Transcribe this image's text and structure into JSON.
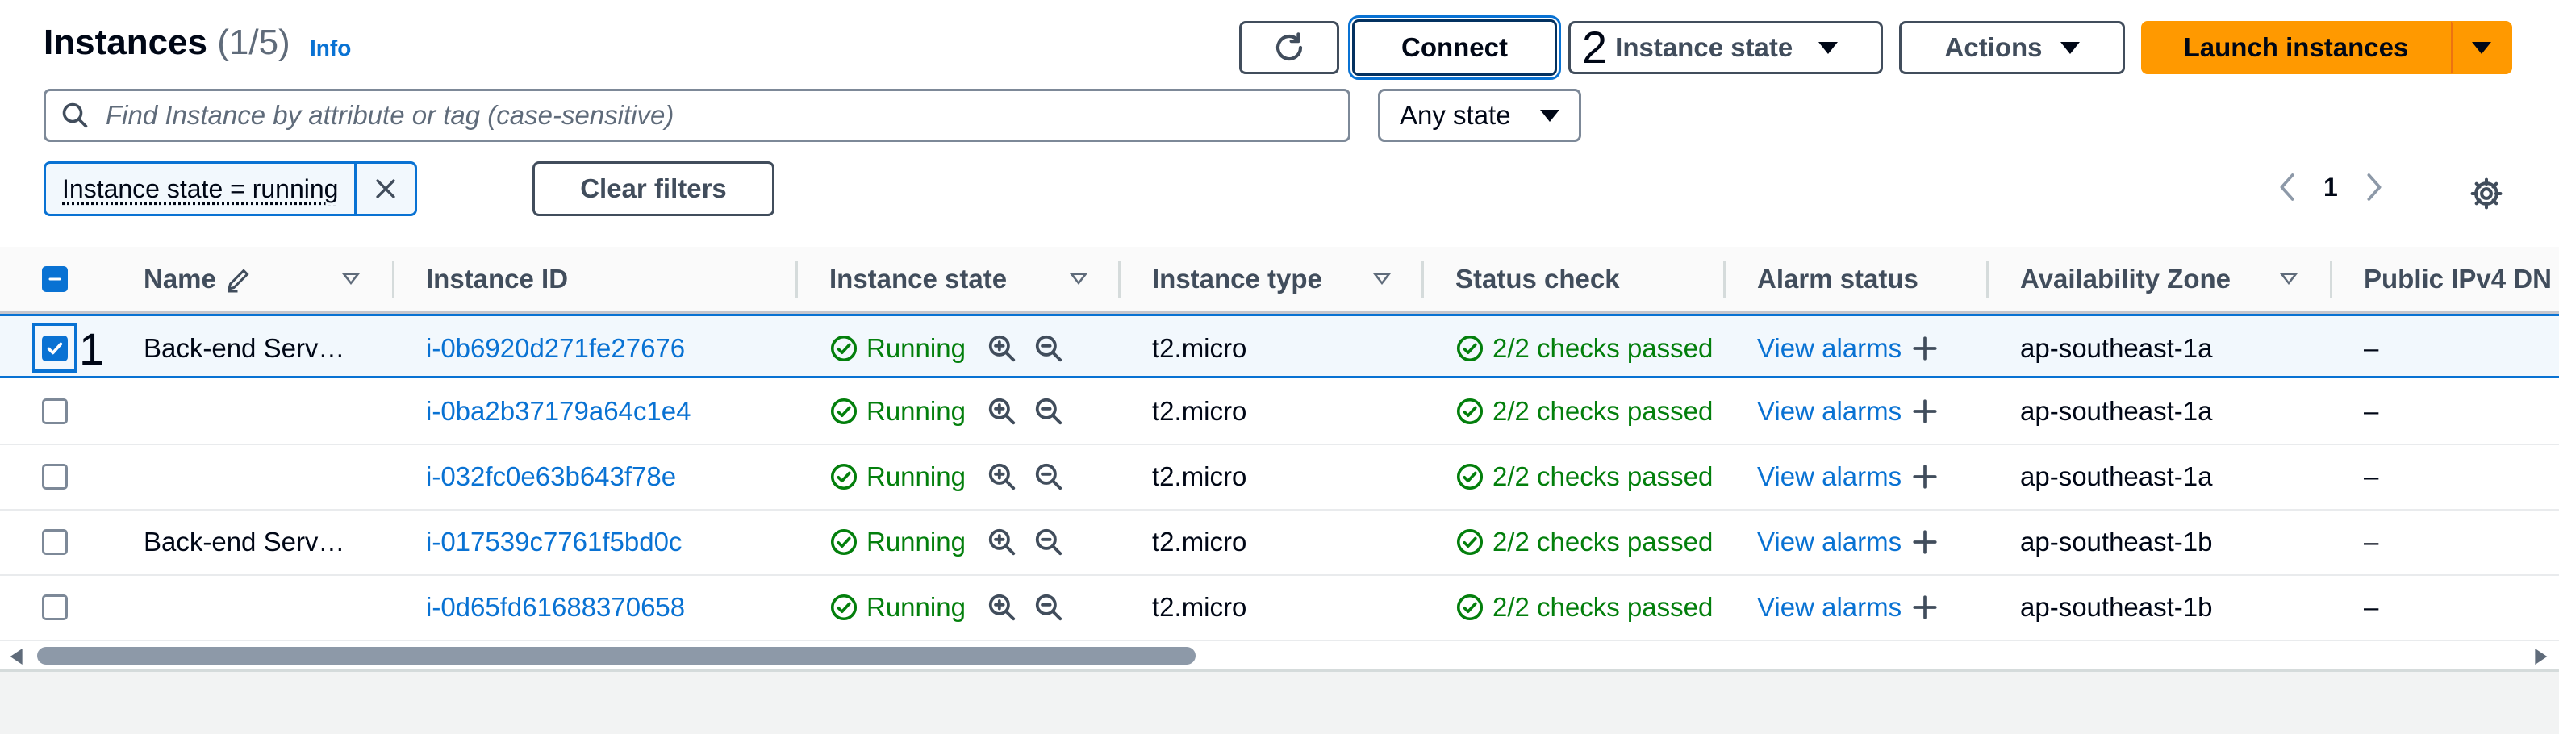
{
  "header": {
    "title": "Instances",
    "count": "(1/5)",
    "info": "Info"
  },
  "toolbar": {
    "connect_label": "Connect",
    "instance_state_marker": "2",
    "instance_state_label": "Instance state",
    "actions_label": "Actions",
    "launch_label": "Launch instances"
  },
  "search": {
    "placeholder": "Find Instance by attribute or tag (case-sensitive)",
    "state_filter": "Any state"
  },
  "filters": {
    "token": "Instance state = running",
    "clear_label": "Clear filters"
  },
  "pagination": {
    "page": "1"
  },
  "table": {
    "columns": [
      "Name",
      "Instance ID",
      "Instance state",
      "Instance type",
      "Status check",
      "Alarm status",
      "Availability Zone",
      "Public IPv4 DN"
    ],
    "rows": [
      {
        "selected": true,
        "marker": "1",
        "name": "Back-end Serv…",
        "id": "i-0b6920d271fe27676",
        "state": "Running",
        "type": "t2.micro",
        "status": "2/2 checks passed",
        "alarm": "View alarms",
        "az": "ap-southeast-1a",
        "ipv4": "–"
      },
      {
        "selected": false,
        "marker": "",
        "name": "",
        "id": "i-0ba2b37179a64c1e4",
        "state": "Running",
        "type": "t2.micro",
        "status": "2/2 checks passed",
        "alarm": "View alarms",
        "az": "ap-southeast-1a",
        "ipv4": "–"
      },
      {
        "selected": false,
        "marker": "",
        "name": "",
        "id": "i-032fc0e63b643f78e",
        "state": "Running",
        "type": "t2.micro",
        "status": "2/2 checks passed",
        "alarm": "View alarms",
        "az": "ap-southeast-1a",
        "ipv4": "–"
      },
      {
        "selected": false,
        "marker": "",
        "name": "Back-end Serv…",
        "id": "i-017539c7761f5bd0c",
        "state": "Running",
        "type": "t2.micro",
        "status": "2/2 checks passed",
        "alarm": "View alarms",
        "az": "ap-southeast-1b",
        "ipv4": "–"
      },
      {
        "selected": false,
        "marker": "",
        "name": "",
        "id": "i-0d65fd61688370658",
        "state": "Running",
        "type": "t2.micro",
        "status": "2/2 checks passed",
        "alarm": "View alarms",
        "az": "ap-southeast-1b",
        "ipv4": "–"
      }
    ]
  },
  "colors": {
    "accent": "#0972d3",
    "launch": "#ff9900",
    "success": "#037f0c"
  },
  "icons": [
    "refresh-icon",
    "caret-down-icon",
    "search-icon",
    "close-icon",
    "chevron-left-icon",
    "chevron-right-icon",
    "gear-icon",
    "edit-icon",
    "sort-icon",
    "check-circle-icon",
    "zoom-in-icon",
    "zoom-out-icon",
    "plus-icon"
  ]
}
